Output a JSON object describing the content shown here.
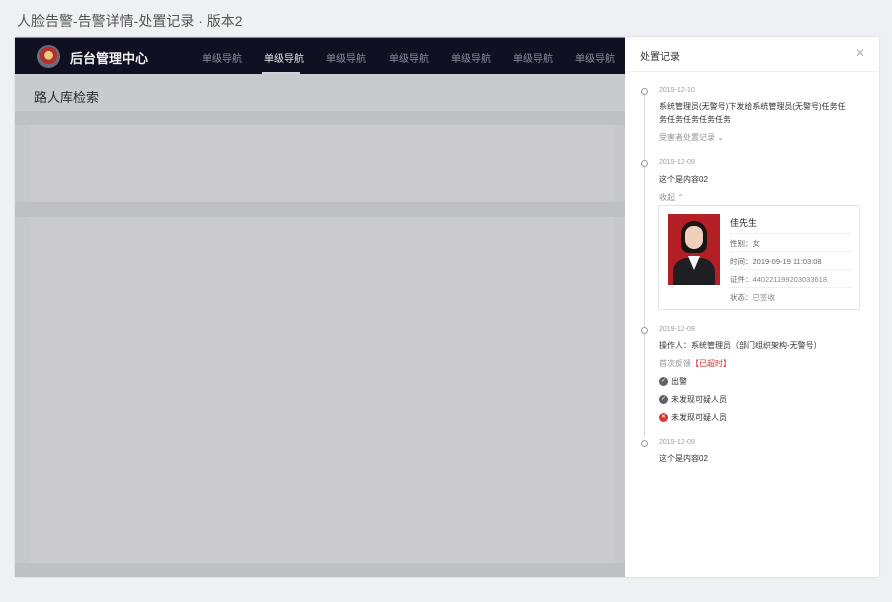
{
  "page_title": "人脸告警-告警详情-处置记录 · 版本2",
  "app": {
    "brand": "后台管理中心",
    "nav": [
      "单级导航",
      "单级导航",
      "单级导航",
      "单级导航",
      "单级导航",
      "单级导航",
      "单级导航"
    ],
    "active_nav_index": 1,
    "subhead_title": "路人库检索"
  },
  "drawer": {
    "title": "处置记录",
    "close_icon": "close-icon",
    "entries": [
      {
        "date": "2019-12-10",
        "text_line1": "系统管理员(无警号)下发给系统管理员(无警号)任务任",
        "text_line2": "务任务任务任务任务",
        "link": "受害者处置记录 ⌄"
      },
      {
        "date": "2019-12-09",
        "text": "这个是内容02",
        "link": "收起 ⌃",
        "card": {
          "name": "佳先生",
          "gender": "性别：女",
          "time": "时间：2019-09-19 11:03:08",
          "id_label": "证件：",
          "id_value": "440221199203033618",
          "state_label": "状态：",
          "state_value": "已签收"
        }
      },
      {
        "date": "2019-12-09",
        "operator": "操作人：系统管理员（部门组织架构-无警号）",
        "feedback_label": "首次反馈",
        "feedback_tag": "【已超时】",
        "statuses": [
          {
            "label": "出警",
            "kind": "ok"
          },
          {
            "label": "未发现可疑人员",
            "kind": "ok"
          },
          {
            "label": "未发现可疑人员",
            "kind": "bad"
          }
        ]
      },
      {
        "date": "2019-12-09",
        "text": "这个是内容02"
      }
    ]
  },
  "colors": {
    "accent_red": "#d42f2f",
    "topbar": "#0f1022"
  }
}
